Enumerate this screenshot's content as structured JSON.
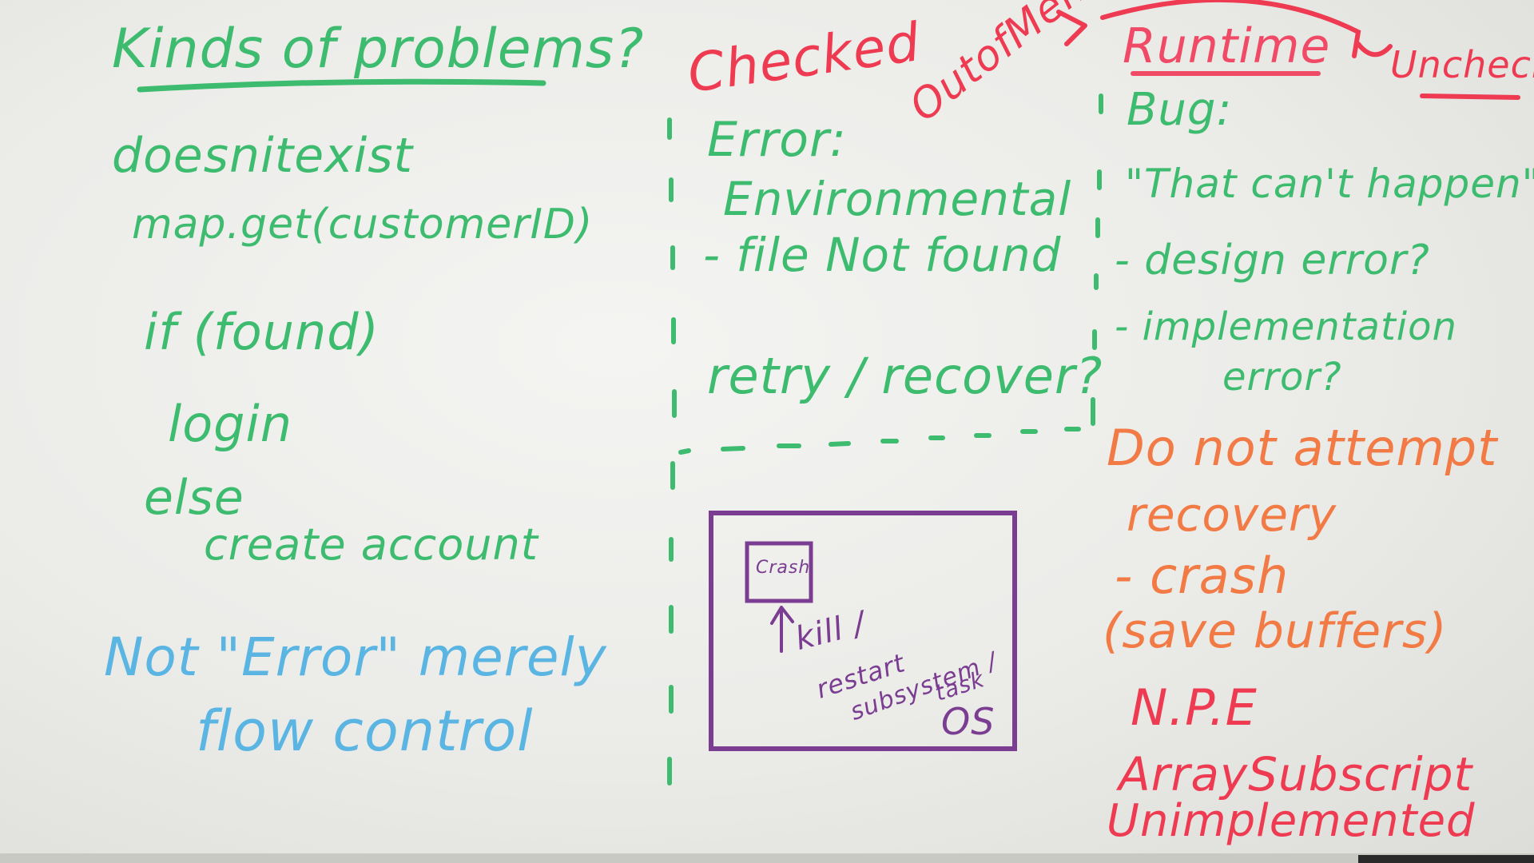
{
  "left_column": {
    "heading": "Kinds of problems?",
    "lines": [
      "doesnitexist",
      "map.get(customerID)",
      "if (found)",
      "login",
      "else",
      "create account"
    ],
    "note_line1": "Not \"Error\" merely",
    "note_line2": "flow control"
  },
  "middle_column": {
    "heading": "Checked",
    "diagonal_label": "OutofMemory",
    "lines": [
      "Error:",
      "Environmental",
      "- file Not found",
      "retry / recover?"
    ]
  },
  "os_box": {
    "inner_box_text": "Crash",
    "lines": [
      "kill /",
      "restart",
      "subsystem /",
      "task",
      "OS"
    ]
  },
  "right_column": {
    "heading": "Runtime",
    "unchecked_label": "Unchecked",
    "lines": [
      "Bug:",
      "\"That can't happen\"",
      "- design error?",
      "- implementation",
      "error?"
    ],
    "advice_lines": [
      "Do not attempt",
      "recovery",
      "- crash",
      "(save buffers)"
    ],
    "examples": [
      "N.P.E",
      "ArraySubscript",
      "Unimplemented"
    ]
  },
  "colors": {
    "board": "#ececea",
    "green_marker": "#3dbb6e",
    "blue_marker": "#5ab5e3",
    "red_marker": "#ee3b52",
    "orange_marker": "#f27a45",
    "purple_marker": "#7a3d91"
  }
}
